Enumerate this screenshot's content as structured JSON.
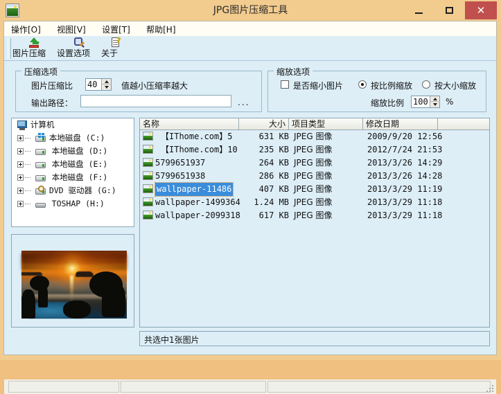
{
  "window": {
    "title": "JPG图片压缩工具",
    "icon": "picture-icon",
    "minimize_label": "–",
    "maximize_label": "□",
    "close_label": "✕"
  },
  "menu": {
    "items": [
      {
        "label": "操作[O]",
        "name": "menu-operation"
      },
      {
        "label": "视图[V]",
        "name": "menu-view"
      },
      {
        "label": "设置[T]",
        "name": "menu-settings"
      },
      {
        "label": "帮助[H]",
        "name": "menu-help"
      }
    ]
  },
  "toolbar": {
    "buttons": [
      {
        "label": "图片压缩",
        "icon": "compress-icon"
      },
      {
        "label": "设置选项",
        "icon": "options-magnifier-icon"
      },
      {
        "label": "关于",
        "icon": "about-info-icon"
      }
    ]
  },
  "compress_group": {
    "legend": "压缩选项",
    "ratio_label": "图片压缩比",
    "ratio_value": "40",
    "ratio_hint": "值越小压缩率越大",
    "output_label": "输出路径：",
    "output_value": "",
    "output_placeholder": "",
    "browse_label": "..."
  },
  "scale_group": {
    "legend": "缩放选项",
    "shrink_checkbox_label": "是否缩小图片",
    "shrink_checked": false,
    "radio_proportional_label": "按比例缩放",
    "radio_size_label": "按大小缩放",
    "radio_selected": "按比例缩放",
    "scale_label": "缩放比例",
    "scale_value": "100",
    "percent_label": "%"
  },
  "tree": {
    "root": {
      "label": "计算机",
      "icon": "computer-icon"
    },
    "nodes": [
      {
        "label": "本地磁盘 (C:)",
        "icon": "drive-windows-icon"
      },
      {
        "label": "本地磁盘 (D:)",
        "icon": "drive-icon"
      },
      {
        "label": "本地磁盘 (E:)",
        "icon": "drive-icon"
      },
      {
        "label": "本地磁盘 (F:)",
        "icon": "drive-icon"
      },
      {
        "label": "DVD 驱动器 (G:)",
        "icon": "dvd-drive-icon"
      },
      {
        "label": "TOSHAP (H:)",
        "icon": "usb-drive-icon"
      }
    ]
  },
  "preview": {
    "alt": "sunset-beach-thumbnail"
  },
  "filelist": {
    "columns": [
      {
        "label": "名称",
        "align": "left"
      },
      {
        "label": "大小",
        "align": "right"
      },
      {
        "label": "项目类型",
        "align": "left"
      },
      {
        "label": "修改日期",
        "align": "left"
      },
      {
        "label": "",
        "align": "left"
      }
    ],
    "rows": [
      {
        "name": "【IThome.com】5",
        "size": "631 KB",
        "type": "JPEG 图像",
        "date": "2009/9/20 12:56",
        "selected": false
      },
      {
        "name": "【IThome.com】10",
        "size": "235 KB",
        "type": "JPEG 图像",
        "date": "2012/7/24 21:53",
        "selected": false
      },
      {
        "name": "5799651937",
        "size": "264 KB",
        "type": "JPEG 图像",
        "date": "2013/3/26 14:29",
        "selected": false
      },
      {
        "name": "5799651938",
        "size": "286 KB",
        "type": "JPEG 图像",
        "date": "2013/3/26 14:28",
        "selected": false
      },
      {
        "name": "wallpaper-11486",
        "size": "407 KB",
        "type": "JPEG 图像",
        "date": "2013/3/29 11:19",
        "selected": true
      },
      {
        "name": "wallpaper-1499364",
        "size": "1.24 MB",
        "type": "JPEG 图像",
        "date": "2013/3/29 11:18",
        "selected": false
      },
      {
        "name": "wallpaper-2099318",
        "size": "617 KB",
        "type": "JPEG 图像",
        "date": "2013/3/29 11:18",
        "selected": false
      }
    ],
    "status": "共选中1张图片"
  },
  "statusbar": {
    "panes": [
      "",
      "",
      ""
    ]
  },
  "colors": {
    "titlebar": "#f2cb8e",
    "close_button": "#c0504d",
    "client_background": "#ddeef7",
    "selection": "#3a8ddb",
    "panel_border": "#8aa6b6"
  }
}
